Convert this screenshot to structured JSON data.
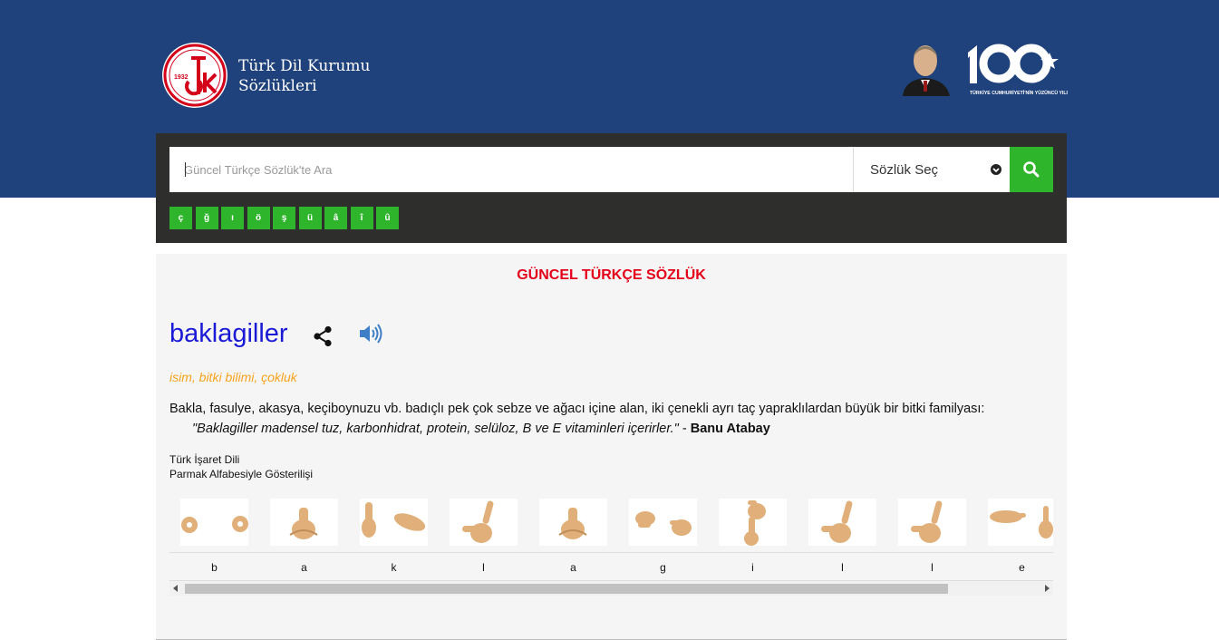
{
  "header": {
    "brand_line1": "Türk Dil Kurumu",
    "brand_line2": "Sözlükleri",
    "logo_year": "1932",
    "centennial_text": "TÜRKİYE CUMHURİYETİ'NİN YÜZÜNCÜ YILI",
    "colors": {
      "band": "#1f427c",
      "logo_red": "#d4001a"
    }
  },
  "search": {
    "placeholder": "Güncel Türkçe Sözlük'te Ara",
    "select_label": "Sözlük Seç",
    "search_icon": "search-icon",
    "special_chars": [
      "ç",
      "ğ",
      "ı",
      "ö",
      "ş",
      "ü",
      "â",
      "î",
      "û"
    ],
    "accent": "#2fb52c"
  },
  "result": {
    "dictionary_title": "GÜNCEL TÜRKÇE SÖZLÜK",
    "word": "baklagiller",
    "part_of_speech": "isim, bitki bilimi, çokluk",
    "definition": "Bakla, fasulye, akasya, keçiboynuzu vb. badıçlı pek çok sebze ve ağacı içine alan, iki çenekli ayrı taç yapraklılardan büyük bir bitki familyası:",
    "example_text": "\"Baklagiller madensel tuz, karbonhidrat, protein, selüloz, B ve E vitaminleri içerirler.\"",
    "example_separator": " - ",
    "example_author": "Banu Atabay",
    "sign_language_label": "Türk İşaret Dili",
    "finger_alphabet_label": "Parmak Alfabesiyle Gösterilişi",
    "letters": [
      "b",
      "a",
      "k",
      "l",
      "a",
      "g",
      "i",
      "l",
      "l",
      "e"
    ],
    "colors": {
      "title": "#e5001a",
      "word": "#1a1ad6",
      "pos": "#f7a21b"
    }
  }
}
